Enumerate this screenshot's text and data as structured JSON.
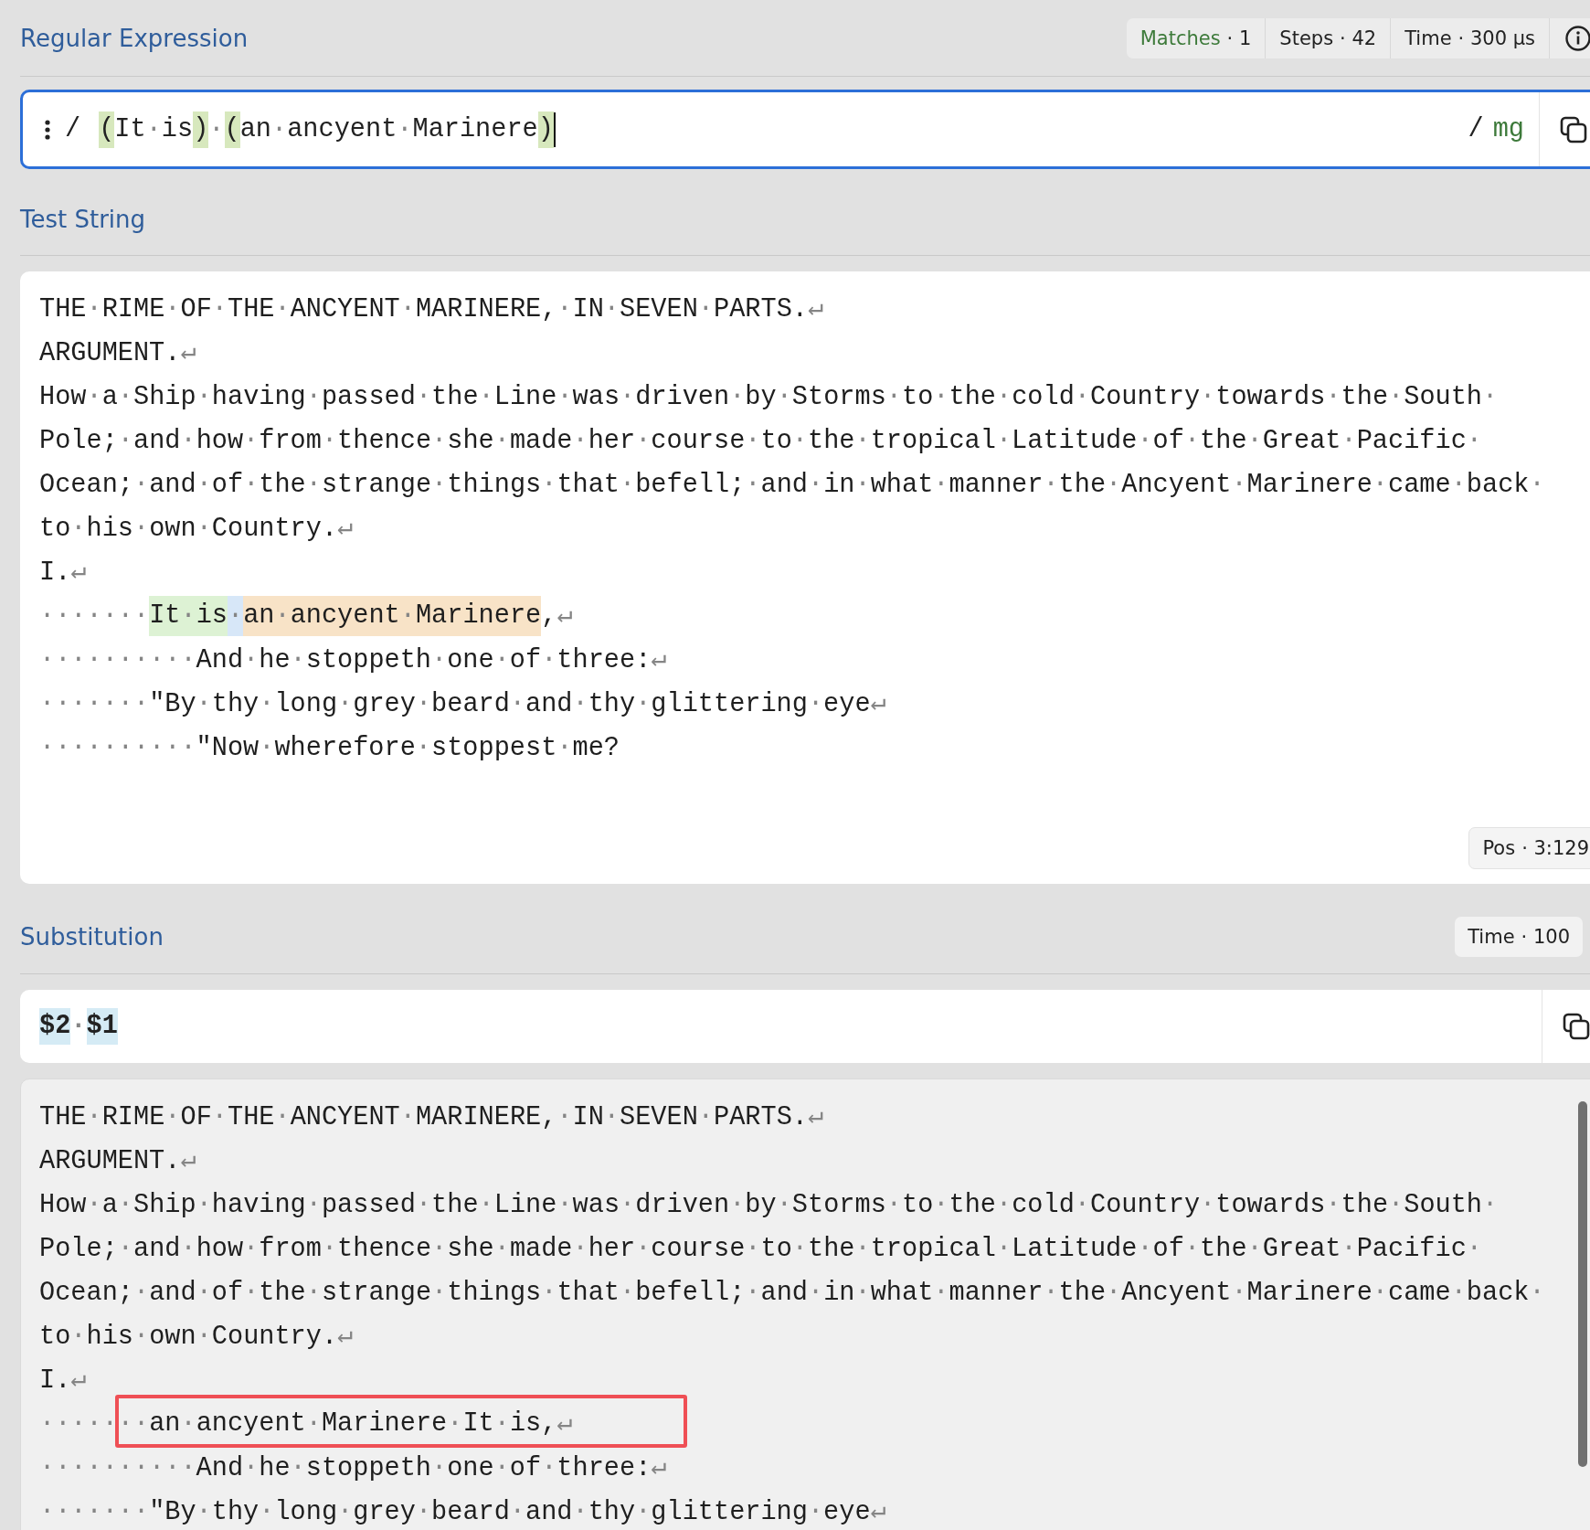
{
  "regex_section": {
    "title": "Regular Expression",
    "stats": [
      {
        "label": "Matches",
        "value": "· 1",
        "kind": "matches"
      },
      {
        "label": "Steps",
        "value": "· 42",
        "kind": "plain"
      },
      {
        "label": "Time",
        "value": "· 300 µs",
        "kind": "plain"
      }
    ],
    "field": {
      "delimiter_open": "/",
      "pattern": [
        {
          "text": "(",
          "kind": "paren"
        },
        {
          "text": "It·is",
          "kind": "text"
        },
        {
          "text": ")",
          "kind": "paren"
        },
        {
          "text": "·",
          "kind": "text"
        },
        {
          "text": "(",
          "kind": "paren"
        },
        {
          "text": "an·ancyent·Marinere",
          "kind": "text"
        },
        {
          "text": ")",
          "kind": "paren"
        }
      ],
      "cursor": true,
      "delimiter_close": "/",
      "flags": "mg"
    }
  },
  "test_string": {
    "title": "Test String",
    "lines": [
      [
        {
          "text": "THE·RIME·OF·THE·ANCYENT·MARINERE,·IN·SEVEN·PARTS.↵",
          "kind": "plain"
        }
      ],
      [
        {
          "text": "ARGUMENT.↵",
          "kind": "plain"
        }
      ],
      [
        {
          "text": "How·a·Ship·having·passed·the·Line·was·driven·by·Storms·to·the·cold·Country·towards·the·South·",
          "kind": "plain"
        }
      ],
      [
        {
          "text": "Pole;·and·how·from·thence·she·made·her·course·to·the·tropical·Latitude·of·the·Great·Pacific·",
          "kind": "plain"
        }
      ],
      [
        {
          "text": "Ocean;·and·of·the·strange·things·that·befell;·and·in·what·manner·the·Ancyent·Marinere·came·back·",
          "kind": "plain"
        }
      ],
      [
        {
          "text": "to·his·own·Country.↵",
          "kind": "plain"
        }
      ],
      [
        {
          "text": "I.↵",
          "kind": "plain"
        }
      ],
      [
        {
          "text": "·······",
          "kind": "plain"
        },
        {
          "text": "It·is",
          "kind": "group1"
        },
        {
          "text": "·",
          "kind": "gap"
        },
        {
          "text": "an·ancyent·Marinere",
          "kind": "group2"
        },
        {
          "text": ",↵",
          "kind": "plain"
        }
      ],
      [
        {
          "text": "··········And·he·stoppeth·one·of·three:↵",
          "kind": "plain"
        }
      ],
      [
        {
          "text": "·······\"By·thy·long·grey·beard·and·thy·glittering·eye↵",
          "kind": "plain"
        }
      ],
      [
        {
          "text": "··········\"Now·wherefore·stoppest·me?",
          "kind": "plain"
        }
      ]
    ],
    "position": {
      "label": "Pos",
      "value": "· 3:129"
    }
  },
  "substitution": {
    "title": "Substitution",
    "stats": [
      {
        "label": "Time",
        "value": "· 100"
      }
    ],
    "replacement": [
      {
        "text": "$2",
        "kind": "token"
      },
      {
        "text": "·",
        "kind": "text"
      },
      {
        "text": "$1",
        "kind": "token"
      }
    ],
    "result_lines": [
      [
        {
          "text": "THE·RIME·OF·THE·ANCYENT·MARINERE,·IN·SEVEN·PARTS.↵",
          "boxed": false
        }
      ],
      [
        {
          "text": "ARGUMENT.↵",
          "boxed": false
        }
      ],
      [
        {
          "text": "How·a·Ship·having·passed·the·Line·was·driven·by·Storms·to·the·cold·Country·towards·the·South·",
          "boxed": false
        }
      ],
      [
        {
          "text": "Pole;·and·how·from·thence·she·made·her·course·to·the·tropical·Latitude·of·the·Great·Pacific·",
          "boxed": false
        }
      ],
      [
        {
          "text": "Ocean;·and·of·the·strange·things·that·befell;·and·in·what·manner·the·Ancyent·Marinere·came·back·",
          "boxed": false
        }
      ],
      [
        {
          "text": "to·his·own·Country.↵",
          "boxed": false
        }
      ],
      [
        {
          "text": "I.↵",
          "boxed": false
        }
      ],
      [
        {
          "text": "·····",
          "boxed": false
        },
        {
          "text": "··an·ancyent·Marinere·It·is,↵",
          "boxed": true
        }
      ],
      [
        {
          "text": "··········And·he·stoppeth·one·of·three:↵",
          "boxed": false
        }
      ],
      [
        {
          "text": "·······\"By·thy·long·grey·beard·and·thy·glittering·eye↵",
          "boxed": false
        }
      ]
    ]
  }
}
